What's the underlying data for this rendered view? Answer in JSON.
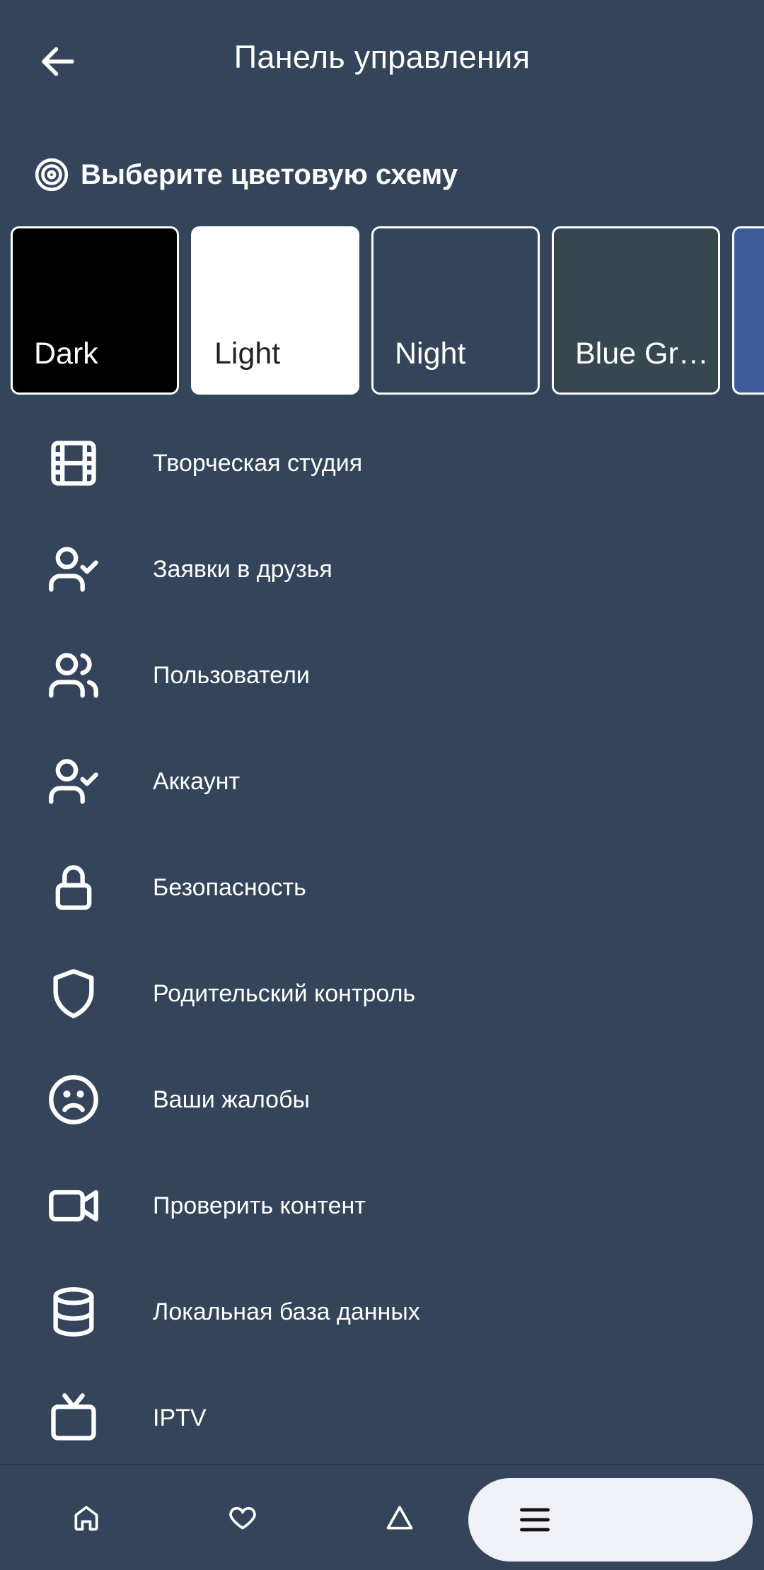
{
  "header": {
    "title": "Панель управления"
  },
  "color_scheme": {
    "title": "Выберите цветовую схему",
    "themes": [
      {
        "name": "Dark",
        "bg": "#000000",
        "text": "#ffffff"
      },
      {
        "name": "Light",
        "bg": "#ffffff",
        "text": "#222222"
      },
      {
        "name": "Night",
        "bg": "#34445b",
        "text": "#ffffff"
      },
      {
        "name": "Blue Gr…",
        "bg": "#37474f",
        "text": "#ffffff"
      },
      {
        "name": "",
        "bg": "#3d5a99",
        "text": "#ffffff"
      }
    ]
  },
  "menu": [
    {
      "label": "Творческая студия",
      "icon": "film-icon"
    },
    {
      "label": "Заявки в друзья",
      "icon": "user-check-icon"
    },
    {
      "label": "Пользователи",
      "icon": "users-icon"
    },
    {
      "label": "Аккаунт",
      "icon": "user-check-icon"
    },
    {
      "label": "Безопасность",
      "icon": "lock-icon"
    },
    {
      "label": "Родительский контроль",
      "icon": "shield-icon"
    },
    {
      "label": "Ваши жалобы",
      "icon": "sad-face-icon"
    },
    {
      "label": "Проверить контент",
      "icon": "video-icon"
    },
    {
      "label": "Локальная база данных",
      "icon": "database-icon"
    },
    {
      "label": "IPTV",
      "icon": "tv-icon"
    }
  ],
  "bottom_nav": {
    "items": [
      "home-icon",
      "heart-icon",
      "triangle-icon",
      "menu-icon"
    ],
    "active": "menu-icon"
  },
  "colors": {
    "background": "#34445b",
    "text": "#ffffff",
    "active_pill": "#eff1f6"
  }
}
